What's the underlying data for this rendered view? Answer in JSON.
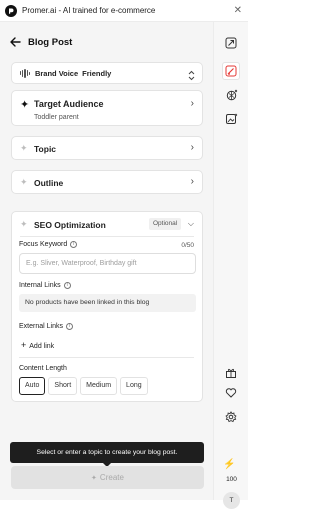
{
  "app": {
    "title": "Promer.ai - AI trained for e-commerce"
  },
  "header": {
    "title": "Blog Post"
  },
  "brand_voice": {
    "label": "Brand Voice",
    "value": "Friendly"
  },
  "target_audience": {
    "title": "Target Audience",
    "value": "Toddler parent"
  },
  "topic": {
    "title": "Topic"
  },
  "outline": {
    "title": "Outline"
  },
  "seo": {
    "title": "SEO Optimization",
    "badge": "Optional",
    "focus_keyword": {
      "label": "Focus Keyword",
      "count": "0/50",
      "placeholder": "E.g. Sliver, Waterproof, Birthday gift"
    },
    "internal_links": {
      "label": "Internal Links",
      "empty_text": "No products have been linked in this blog"
    },
    "external_links": {
      "label": "External Links",
      "add_label": "Add link"
    },
    "content_length": {
      "label": "Content Length",
      "options": [
        "Auto",
        "Short",
        "Medium",
        "Long"
      ],
      "selected": "Auto"
    }
  },
  "tooltip": {
    "text": "Select or enter a topic to create your blog post."
  },
  "create_button": {
    "label": "Create"
  },
  "rail": {
    "credits": "100",
    "avatar": "T"
  },
  "colors": {
    "accent_red": "#e53935",
    "tooltip_bg": "#1e1e1e",
    "disabled": "#e2e2e2"
  }
}
